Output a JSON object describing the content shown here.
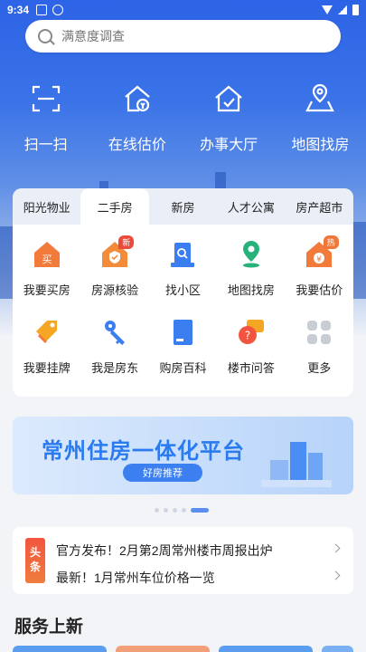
{
  "status": {
    "time": "9:34"
  },
  "search": {
    "placeholder": "满意度调查"
  },
  "quick_actions": [
    {
      "label": "扫一扫",
      "icon": "scan-icon"
    },
    {
      "label": "在线估价",
      "icon": "house-valuation-icon"
    },
    {
      "label": "办事大厅",
      "icon": "service-hall-icon"
    },
    {
      "label": "地图找房",
      "icon": "map-icon"
    }
  ],
  "tabs": [
    {
      "label": "阳光物业",
      "active": false
    },
    {
      "label": "二手房",
      "active": true
    },
    {
      "label": "新房",
      "active": false
    },
    {
      "label": "人才公寓",
      "active": false
    },
    {
      "label": "房产超市",
      "active": false
    }
  ],
  "grid": [
    {
      "label": "我要买房",
      "icon": "buy-house-icon"
    },
    {
      "label": "房源核验",
      "icon": "verify-house-icon",
      "badge": "新"
    },
    {
      "label": "找小区",
      "icon": "find-community-icon"
    },
    {
      "label": "地图找房",
      "icon": "map-pin-icon"
    },
    {
      "label": "我要估价",
      "icon": "valuation-icon",
      "badge": "热"
    },
    {
      "label": "我要挂牌",
      "icon": "listing-tag-icon"
    },
    {
      "label": "我是房东",
      "icon": "landlord-key-icon"
    },
    {
      "label": "购房百科",
      "icon": "encyclopedia-icon"
    },
    {
      "label": "楼市问答",
      "icon": "qa-icon"
    },
    {
      "label": "更多",
      "icon": "more-icon"
    }
  ],
  "banner": {
    "title": "常州住房一体化平台",
    "button": "好房推荐"
  },
  "news": {
    "tag_1": "头",
    "tag_2": "条",
    "items": [
      "官方发布！2月第2周常州楼市周报出炉",
      "最新！1月常州车位价格一览"
    ]
  },
  "section": {
    "title": "服务上新"
  },
  "colors": {
    "primary": "#3b7ff0",
    "orange": "#f0773a",
    "badge_red": "#ea4b3c"
  }
}
